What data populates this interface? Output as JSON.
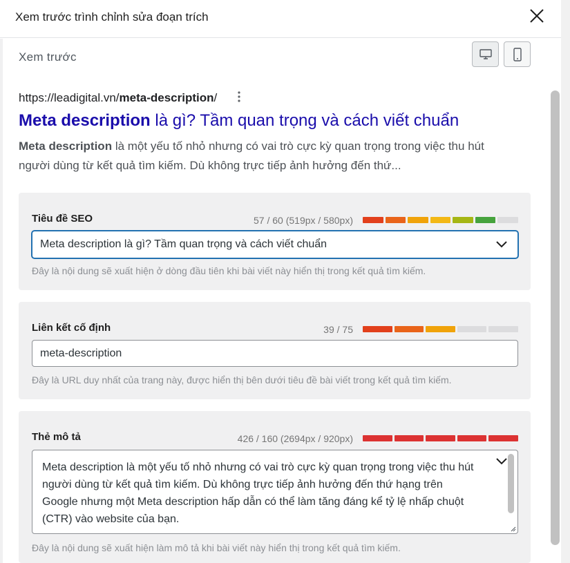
{
  "window": {
    "title": "Xem trước trình chỉnh sửa đoạn trích",
    "close_icon": "close-icon"
  },
  "preview": {
    "label": "Xem trước",
    "devices": [
      "desktop-icon",
      "mobile-icon"
    ]
  },
  "serp": {
    "url_prefix": "https://leadigital.vn/",
    "url_slug": "meta-description",
    "url_suffix": "/",
    "title_bold": "Meta description",
    "title_rest": " là gì? Tầm quan trọng và cách viết chuẩn",
    "desc_bold": "Meta description",
    "desc_rest": " là một yếu tố nhỏ nhưng có vai trò cực kỳ quan trọng trong việc thu hút người dùng từ kết quả tìm kiếm. Dù không trực tiếp ảnh hưởng đến thứ..."
  },
  "seo_title": {
    "label": "Tiêu đề SEO",
    "count": "57 / 60 (519px / 580px)",
    "meter_colors": [
      "#e2401c",
      "#e9641a",
      "#f0a30a",
      "#f3b815",
      "#a5b614",
      "#46a33d",
      "#dcdcde"
    ],
    "value": "Meta description là gì? Tầm quan trọng và cách viết chuẩn",
    "hint": "Đây là nội dung sẽ xuất hiện ở dòng đầu tiên khi bài viết này hiển thị trong kết quả tìm kiếm."
  },
  "permalink": {
    "label": "Liên kết cố định",
    "count": "39 / 75",
    "meter_colors": [
      "#e2401c",
      "#e9641a",
      "#f0a30a",
      "#dcdcde",
      "#dcdcde"
    ],
    "value": "meta-description",
    "hint": "Đây là URL duy nhất của trang này, được hiển thị bên dưới tiêu đề bài viết trong kết quả tìm kiếm."
  },
  "description": {
    "label": "Thẻ mô tả",
    "count": "426 / 160 (2694px / 920px)",
    "meter_colors": [
      "#dc3232",
      "#dc3232",
      "#dc3232",
      "#dc3232",
      "#dc3232"
    ],
    "value": "Meta description là một yếu tố nhỏ nhưng có vai trò cực kỳ quan trọng trong việc thu hút người dùng từ kết quả tìm kiếm. Dù không trực tiếp ảnh hưởng đến thứ hạng trên Google nhưng một Meta description hấp dẫn có thể làm tăng đáng kể tỷ lệ nhấp chuột (CTR) vào website của bạn.",
    "hint": "Đây là nội dung sẽ xuất hiện làm mô tả khi bài viết này hiển thị trong kết quả tìm kiếm."
  }
}
